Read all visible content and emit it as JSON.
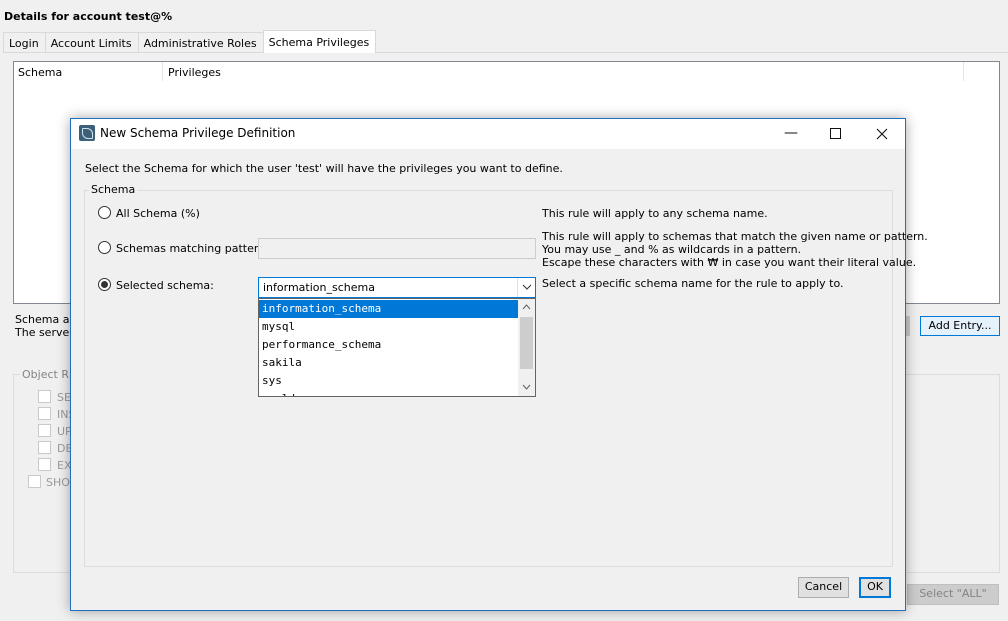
{
  "background": {
    "title": "Details for account test@%",
    "tabs": [
      "Login",
      "Account Limits",
      "Administrative Roles",
      "Schema Privileges"
    ],
    "active_tab": "Schema Privileges",
    "grid_columns": [
      "Schema",
      "Privileges"
    ],
    "info_line1": "Schema and",
    "info_line2": "The server",
    "add_entry_label": "Add Entry...",
    "select_all_label": "Select \"ALL\"",
    "object_rights_label": "Object Rig",
    "object_checkboxes": [
      "SE",
      "INS",
      "UP",
      "DE",
      "EXI"
    ],
    "show_label": "SHOV"
  },
  "dialog": {
    "title": "New Schema Privilege Definition",
    "prompt": "Select the Schema for which the user 'test' will have the privileges you want to define.",
    "group_label": "Schema",
    "options": [
      {
        "label": "All Schema (%)",
        "selected": false,
        "description": [
          "This rule will apply to any schema name."
        ]
      },
      {
        "label": "Schemas matching pattern:",
        "selected": false,
        "description": [
          "This rule will apply to schemas that match the given name or pattern.",
          "You may use _ and % as wildcards in a pattern.",
          "Escape these characters with ₩ in case you want their literal value."
        ]
      },
      {
        "label": "Selected schema:",
        "selected": true,
        "description": [
          "Select a specific schema name for the rule to apply to."
        ]
      }
    ],
    "pattern_value": "",
    "selected_schema": "information_schema",
    "dropdown_items": [
      "information_schema",
      "mysql",
      "performance_schema",
      "sakila",
      "sys",
      "world"
    ],
    "highlighted_item": "information_schema",
    "cancel_label": "Cancel",
    "ok_label": "OK",
    "window_controls": {
      "minimize": "minimize-icon",
      "maximize": "maximize-icon",
      "close": "close-icon"
    }
  },
  "colors": {
    "accent": "#0078d7",
    "selection": "#0078d7",
    "dialog_border": "#1f6fbf"
  }
}
